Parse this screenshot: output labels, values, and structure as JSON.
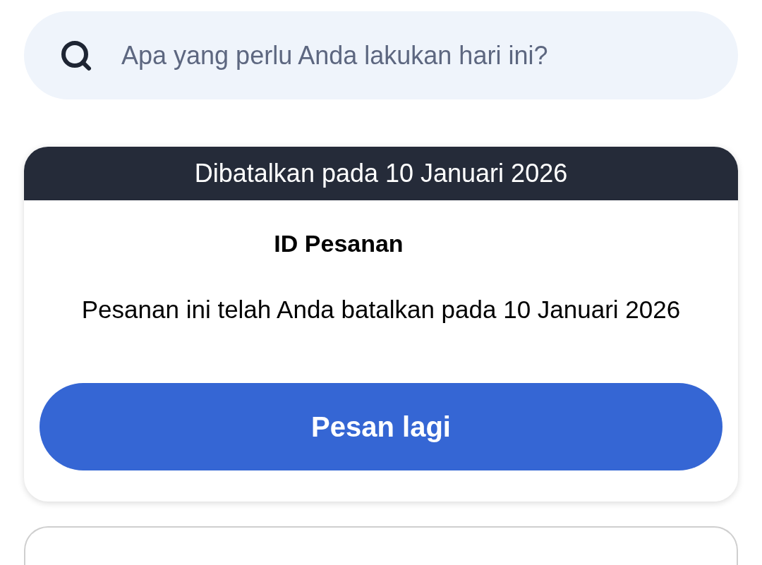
{
  "search": {
    "placeholder": "Apa yang perlu Anda lakukan hari ini?"
  },
  "order_card": {
    "banner": "Dibatalkan pada 10 Januari 2026",
    "order_id": "ID Pesanan",
    "message": "Pesanan ini telah Anda batalkan pada 10 Januari 2026",
    "button": "Pesan lagi"
  }
}
